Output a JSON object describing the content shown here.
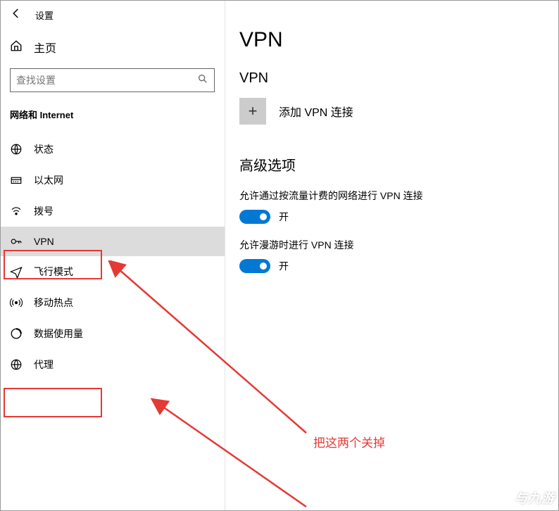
{
  "app": {
    "title": "设置"
  },
  "home": {
    "label": "主页"
  },
  "search": {
    "placeholder": "查找设置"
  },
  "category": {
    "title": "网络和 Internet"
  },
  "nav": {
    "items": [
      {
        "label": "状态",
        "icon": "globe-status"
      },
      {
        "label": "以太网",
        "icon": "ethernet"
      },
      {
        "label": "拨号",
        "icon": "dialup"
      },
      {
        "label": "VPN",
        "icon": "vpn",
        "selected": true
      },
      {
        "label": "飞行模式",
        "icon": "airplane"
      },
      {
        "label": "移动热点",
        "icon": "hotspot"
      },
      {
        "label": "数据使用量",
        "icon": "data-usage"
      },
      {
        "label": "代理",
        "icon": "proxy"
      }
    ]
  },
  "page": {
    "title": "VPN",
    "section_vpn": "VPN",
    "add_vpn": "添加 VPN 连接",
    "advanced": "高级选项",
    "opt1_label": "允许通过按流量计费的网络进行 VPN 连接",
    "opt1_state": "开",
    "opt2_label": "允许漫游时进行 VPN 连接",
    "opt2_state": "开"
  },
  "annotation": {
    "text": "把这两个关掉"
  },
  "watermark": {
    "text": "与九游"
  },
  "colors": {
    "accent": "#0078d4",
    "highlight": "#e53935"
  }
}
